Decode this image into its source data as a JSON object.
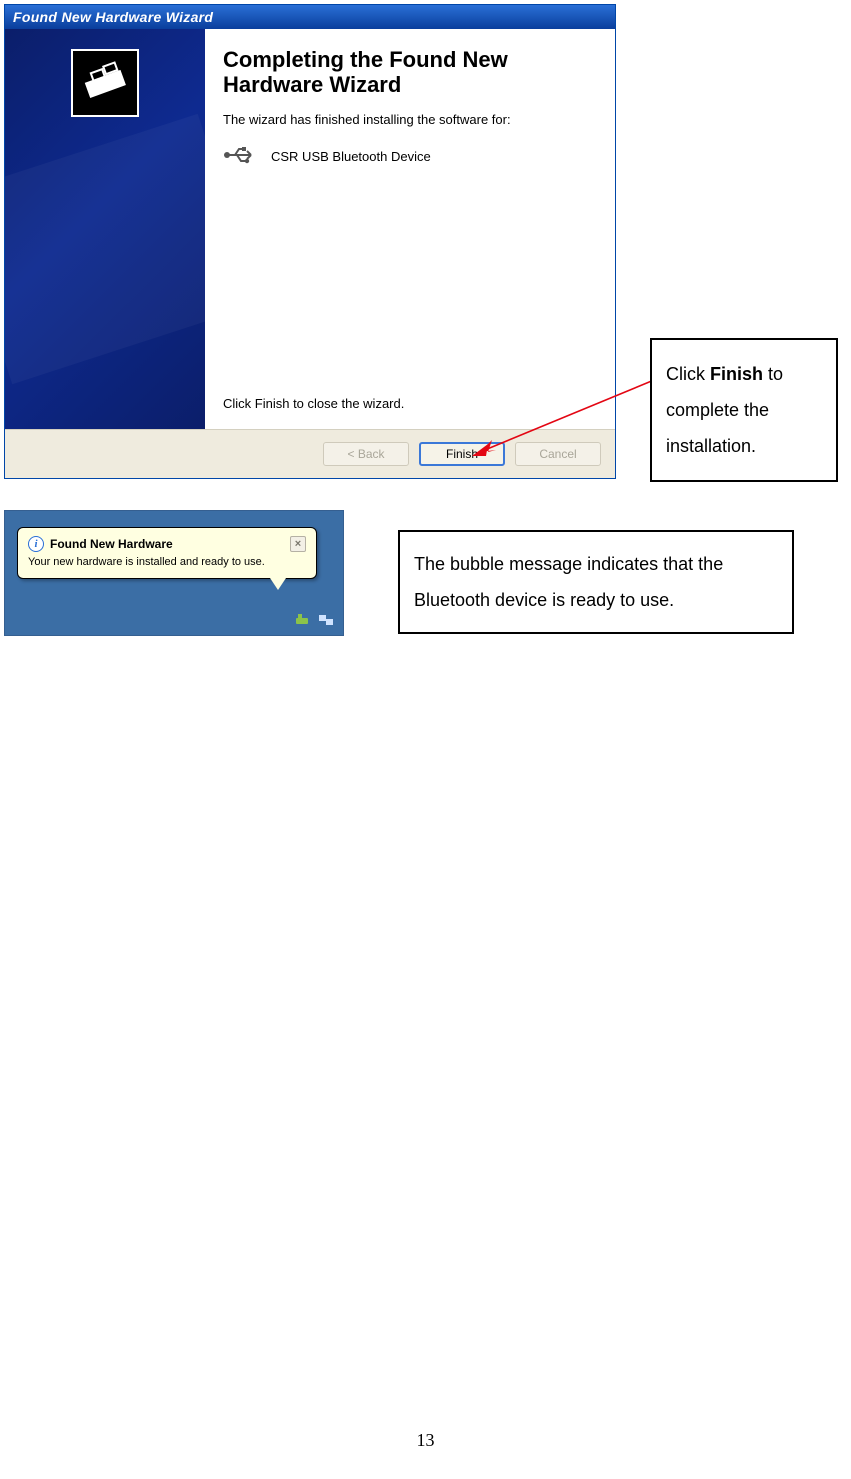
{
  "wizard": {
    "title": "Found New Hardware Wizard",
    "heading": "Completing the Found New Hardware Wizard",
    "subtext": "The wizard has finished installing the software for:",
    "device_name": "CSR USB Bluetooth Device",
    "close_hint": "Click Finish to close the wizard.",
    "buttons": {
      "back": "< Back",
      "finish": "Finish",
      "cancel": "Cancel"
    }
  },
  "callout_finish": {
    "pre": "Click ",
    "bold": "Finish",
    "post": " to complete the installation."
  },
  "balloon": {
    "title": "Found New Hardware",
    "body": "Your new hardware is installed and ready to use.",
    "close_glyph": "×",
    "info_glyph": "i"
  },
  "callout_balloon": "The bubble message indicates that the Bluetooth device is ready to use.",
  "page_number": "13"
}
